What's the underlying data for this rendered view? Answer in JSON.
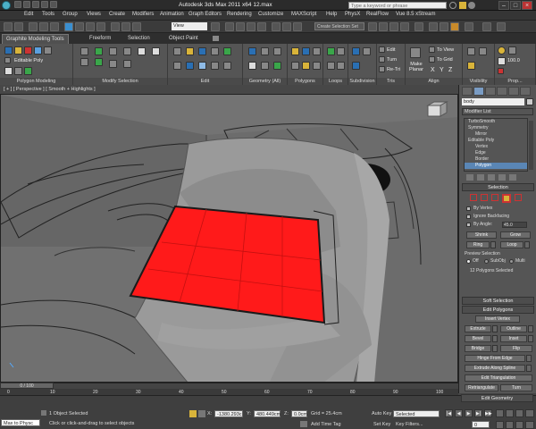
{
  "app": {
    "title": "Autodesk 3ds Max 2011 x64     12.max",
    "search_placeholder": "Type a keyword or phrase"
  },
  "menu": [
    "Edit",
    "Tools",
    "Group",
    "Views",
    "Create",
    "Modifiers",
    "Animation",
    "Graph Editors",
    "Rendering",
    "Customize",
    "MAXScript",
    "Help",
    "PhysX",
    "RealFlow",
    "Vue 8.5 xStream"
  ],
  "quick": {
    "view_select": "View",
    "selection_set": "Create Selection Set"
  },
  "ribbon_tabs": [
    "Graphite Modeling Tools",
    "Freeform",
    "Selection",
    "Object Paint"
  ],
  "ribbon": {
    "editable_poly": "Editable Poly",
    "panels": [
      "Polygon Modeling",
      "Modify Selection",
      "Edit",
      "Geometry (All)",
      "Polygons",
      "Loops",
      "Subdivision",
      "Tris",
      "Align",
      "Visibility",
      "Prop..."
    ],
    "edit_labels": [
      "Edit",
      "Turn",
      "Re-Tri"
    ],
    "make_planar": "Make Planar",
    "align_labels": [
      "To View",
      "To Grid"
    ],
    "xyz": [
      "X",
      "Y",
      "Z"
    ],
    "zoom": "100.0"
  },
  "viewport": {
    "label": "[ + ] [ Perspective ] [ Smooth + Highlights ]"
  },
  "command_panel": {
    "object_name": "body",
    "modifier_list": "Modifier List",
    "stack": [
      "TurboSmooth",
      "Symmetry",
      "Mirror",
      "Editable Poly",
      "Vertex",
      "Edge",
      "Border",
      "Polygon"
    ],
    "selection_rollout": "Selection",
    "by_vertex": "By Vertex",
    "ignore_backfacing": "Ignore Backfacing",
    "by_angle": "By Angle:",
    "angle_value": "45.0",
    "shrink": "Shrink",
    "grow": "Grow",
    "ring": "Ring",
    "loop": "Loop",
    "preview_selection": "Preview Selection",
    "preview_options": [
      "Off",
      "SubObj",
      "Multi"
    ],
    "polys_selected": "12 Polygons Selected",
    "soft_selection": "Soft Selection",
    "edit_polygons": "Edit Polygons",
    "insert_vertex": "Insert Vertex",
    "extrude": "Extrude",
    "outline": "Outline",
    "bevel": "Bevel",
    "inset": "Inset",
    "bridge": "Bridge",
    "flip": "Flip",
    "hinge_from_edge": "Hinge From Edge",
    "extrude_along_spline": "Extrude Along Spline",
    "edit_triangulation": "Edit Triangulation",
    "retriangulate": "Retriangulate",
    "turn": "Turn",
    "edit_geometry": "Edit Geometry"
  },
  "timeline": {
    "slider": "0 / 100",
    "ticks": [
      "0",
      "10",
      "20",
      "30",
      "40",
      "50",
      "60",
      "70",
      "80",
      "90",
      "100"
    ]
  },
  "status": {
    "maxscript": "Max to Physc",
    "selected": "1 Object Selected",
    "prompt": "Click or click-and-drag to select objects",
    "x_label": "X:",
    "x_value": "-1380.293c",
    "y_label": "Y:",
    "y_value": "480.449cm",
    "z_label": "Z:",
    "z_value": "0.0cm",
    "grid": "Grid = 25.4cm",
    "add_time_tag": "Add Time Tag",
    "auto_key": "Auto Key",
    "set_key": "Set Key",
    "key_selected": "Selected",
    "key_filters": "Key Filters...",
    "frame": "0"
  },
  "colors": {
    "selected_face": "#ff1a1a",
    "viewport_bg": "#777777",
    "accent": "#2a6fb3"
  }
}
